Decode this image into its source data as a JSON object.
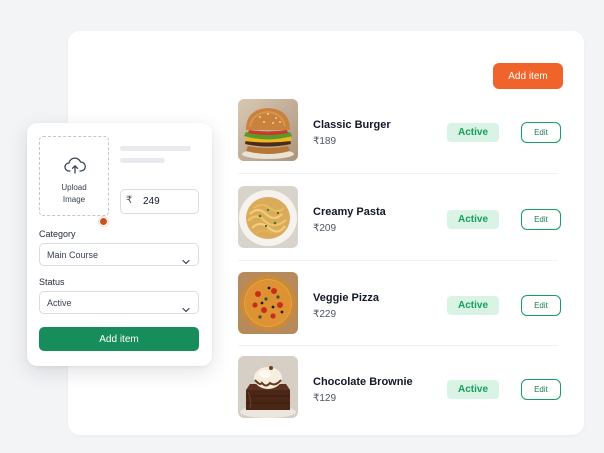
{
  "header": {
    "add_item_label": "Add item"
  },
  "menu_items": [
    {
      "name": "Classic Burger",
      "price": "₹189",
      "status": "Active",
      "edit_label": "Edit",
      "image": "burger-image"
    },
    {
      "name": "Creamy Pasta",
      "price": "₹209",
      "status": "Active",
      "edit_label": "Edit",
      "image": "pasta-image"
    },
    {
      "name": "Veggie Pizza",
      "price": "₹229",
      "status": "Active",
      "edit_label": "Edit",
      "image": "pizza-image"
    },
    {
      "name": "Chocolate Brownie",
      "price": "₹129",
      "status": "Active",
      "edit_label": "Edit",
      "image": "brownie-image"
    }
  ],
  "form": {
    "upload_label_line1": "Upload",
    "upload_label_line2": "Image",
    "upload_icon": "cloud-upload-icon",
    "currency_symbol": "₹",
    "price_value": "249",
    "category_label": "Category",
    "category_value": "Main Course",
    "status_label": "Status",
    "status_value": "Active",
    "submit_label": "Add item"
  },
  "colors": {
    "accent_orange": "#f0642b",
    "primary_green": "#178d5b",
    "badge_bg": "#d9f3e5",
    "badge_text": "#16a05c"
  }
}
